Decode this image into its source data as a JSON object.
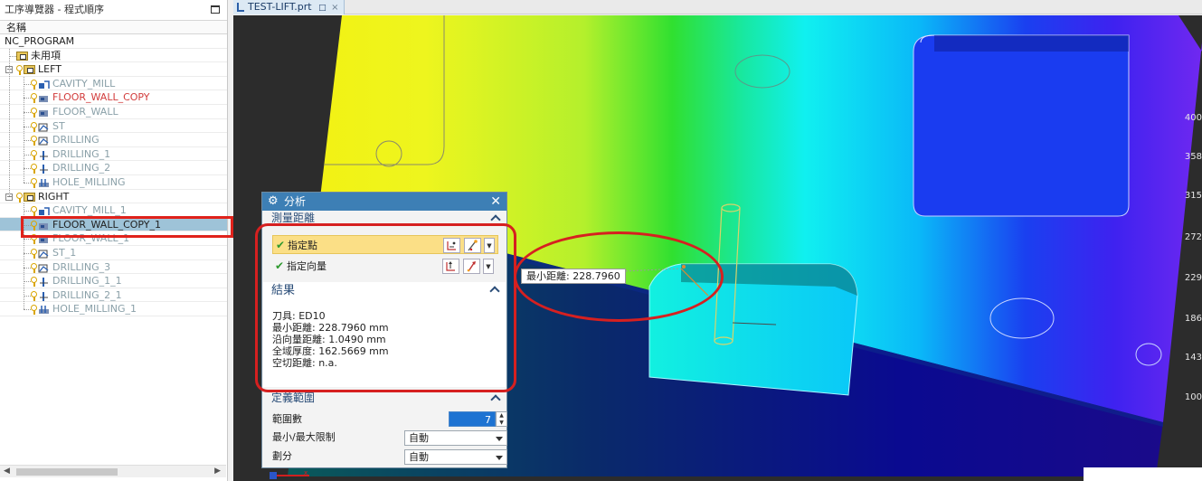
{
  "navigator": {
    "title": "工序導覽器 - 程式順序",
    "column_header": "名稱",
    "rows": [
      {
        "label": "NC_PROGRAM",
        "color": "dark",
        "level": 0,
        "icon": "none"
      },
      {
        "label": "未用項",
        "color": "dark",
        "level": 1,
        "icon": "group"
      },
      {
        "label": "LEFT",
        "color": "dark",
        "level": 1,
        "icon": "group",
        "expanded": true
      },
      {
        "label": "CAVITY_MILL",
        "color": "gray",
        "level": 2,
        "icon": "cavity-mill"
      },
      {
        "label": "FLOOR_WALL_COPY",
        "color": "red",
        "level": 2,
        "icon": "floor-wall"
      },
      {
        "label": "FLOOR_WALL",
        "color": "gray",
        "level": 2,
        "icon": "floor-wall"
      },
      {
        "label": "ST",
        "color": "gray",
        "level": 2,
        "icon": "check"
      },
      {
        "label": "DRILLING",
        "color": "gray",
        "level": 2,
        "icon": "check"
      },
      {
        "label": "DRILLING_1",
        "color": "gray",
        "level": 2,
        "icon": "drill"
      },
      {
        "label": "DRILLING_2",
        "color": "gray",
        "level": 2,
        "icon": "drill"
      },
      {
        "label": "HOLE_MILLING",
        "color": "gray",
        "level": 2,
        "icon": "hole-mill"
      },
      {
        "label": "RIGHT",
        "color": "dark",
        "level": 1,
        "icon": "group",
        "expanded": true
      },
      {
        "label": "CAVITY_MILL_1",
        "color": "gray",
        "level": 2,
        "icon": "cavity-mill"
      },
      {
        "label": "FLOOR_WALL_COPY_1",
        "color": "dark",
        "level": 2,
        "icon": "floor-wall",
        "selected": true
      },
      {
        "label": "FLOOR_WALL_1",
        "color": "gray",
        "level": 2,
        "icon": "floor-wall"
      },
      {
        "label": "ST_1",
        "color": "gray",
        "level": 2,
        "icon": "check"
      },
      {
        "label": "DRILLING_3",
        "color": "gray",
        "level": 2,
        "icon": "check"
      },
      {
        "label": "DRILLING_1_1",
        "color": "gray",
        "level": 2,
        "icon": "drill"
      },
      {
        "label": "DRILLING_2_1",
        "color": "gray",
        "level": 2,
        "icon": "drill"
      },
      {
        "label": "HOLE_MILLING_1",
        "color": "gray",
        "level": 2,
        "icon": "hole-mill"
      }
    ]
  },
  "tab": {
    "label": "TEST-LIFT.prt"
  },
  "viewport": {
    "distance_tip": "最小距離: 228.7960",
    "scale_labels": [
      "400",
      "358",
      "315",
      "272",
      "229",
      "186",
      "143",
      "100"
    ]
  },
  "dialog": {
    "title": "分析",
    "measure_section": "測量距離",
    "specify_point": "指定點",
    "specify_vector": "指定向量",
    "results_section": "結果",
    "results": [
      "刀具: ED10",
      "最小距離: 228.7960 mm",
      "沿向量距離: 1.0490 mm",
      "全域厚度: 162.5669 mm",
      "空切距離: n.a."
    ],
    "range_section": "定義範圍",
    "range_count_label": "範圍數",
    "range_count_value": "7",
    "minmax_label": "最小/最大限制",
    "minmax_value": "自動",
    "divide_label": "劃分",
    "divide_value": "自動"
  },
  "colors": {
    "accent": "#3d7fb5",
    "annotation_red": "#d62020",
    "selected_row": "#9ec3d8",
    "inactive_op": "#8aa0a8",
    "modified_op": "#d23c3c"
  }
}
